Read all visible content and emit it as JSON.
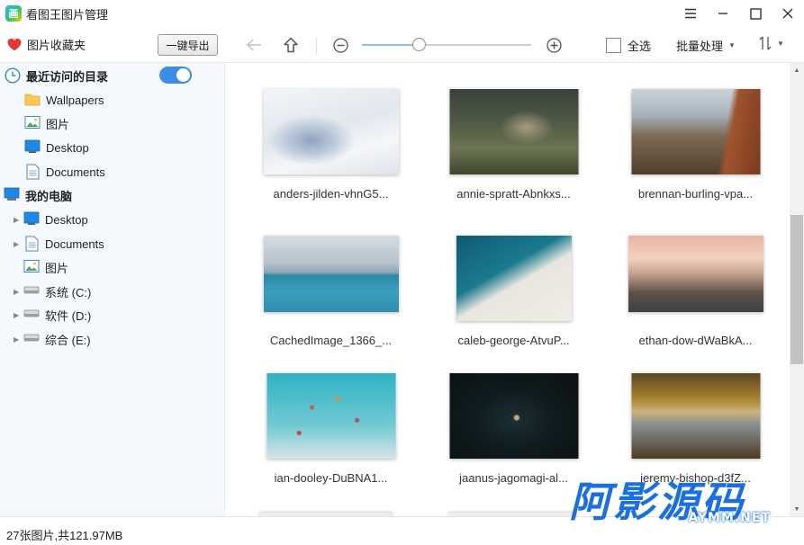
{
  "window": {
    "title": "看图王图片管理"
  },
  "toolbar": {
    "favorites_label": "图片收藏夹",
    "export_label": "一键导出",
    "select_all_label": "全选",
    "batch_label": "批量处理",
    "zoom_level": 0.34
  },
  "sidebar": {
    "recent_label": "最近访问的目录",
    "recent_toggle_on": true,
    "recent_items": [
      {
        "label": "Wallpapers",
        "icon": "folder-icon"
      },
      {
        "label": "图片",
        "icon": "pictures-folder-icon"
      },
      {
        "label": "Desktop",
        "icon": "desktop-icon"
      },
      {
        "label": "Documents",
        "icon": "documents-icon"
      }
    ],
    "computer_label": "我的电脑",
    "computer_items": [
      {
        "label": "Desktop",
        "icon": "desktop-icon"
      },
      {
        "label": "Documents",
        "icon": "documents-icon"
      },
      {
        "label": "图片",
        "icon": "pictures-folder-icon"
      },
      {
        "label": "系统 (C:)",
        "icon": "drive-icon"
      },
      {
        "label": "软件 (D:)",
        "icon": "drive-icon"
      },
      {
        "label": "综合 (E:)",
        "icon": "drive-icon"
      }
    ]
  },
  "images": [
    {
      "name": "anders-jilden-vhnG5..."
    },
    {
      "name": "annie-spratt-Abnkxs..."
    },
    {
      "name": "brennan-burling-vpa..."
    },
    {
      "name": "CachedImage_1366_..."
    },
    {
      "name": "caleb-george-AtvuP..."
    },
    {
      "name": "ethan-dow-dWaBkA..."
    },
    {
      "name": "ian-dooley-DuBNA1..."
    },
    {
      "name": "jaanus-jagomagi-al..."
    },
    {
      "name": "jeremy-bishop-d3fZ..."
    }
  ],
  "status": {
    "text": "27张图片,共121.97MB"
  },
  "watermark": {
    "cn": "阿影源码",
    "en": "AYMM.NET"
  },
  "colors": {
    "accent": "#3c8de6",
    "watermark": "#1b6fe0",
    "favorite_heart": "#e53935"
  }
}
